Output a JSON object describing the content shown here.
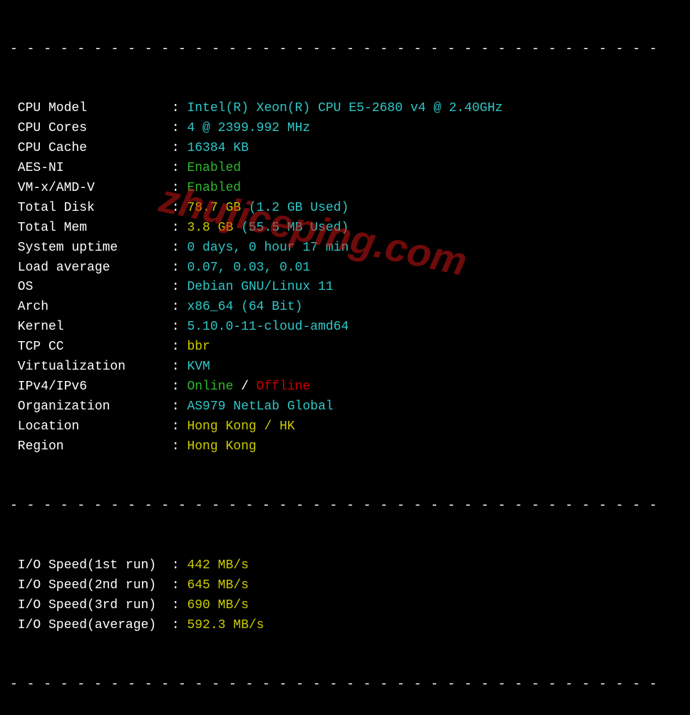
{
  "divider": "- - - - - - - - - - - - - - - - - - - - - - - - - - - - - - - - - - - - - - -",
  "rows": [
    {
      "label": "CPU Model           ",
      "parts": [
        {
          "c": "cyan",
          "t": "Intel(R) Xeon(R) CPU E5-2680 v4 @ 2.40GHz"
        }
      ]
    },
    {
      "label": "CPU Cores           ",
      "parts": [
        {
          "c": "cyan",
          "t": "4 @ 2399.992 MHz"
        }
      ]
    },
    {
      "label": "CPU Cache           ",
      "parts": [
        {
          "c": "cyan",
          "t": "16384 KB"
        }
      ]
    },
    {
      "label": "AES-NI              ",
      "parts": [
        {
          "c": "green",
          "t": "Enabled"
        }
      ]
    },
    {
      "label": "VM-x/AMD-V          ",
      "parts": [
        {
          "c": "green",
          "t": "Enabled"
        }
      ]
    },
    {
      "label": "Total Disk          ",
      "parts": [
        {
          "c": "yellow",
          "t": "78.7 GB "
        },
        {
          "c": "cyan",
          "t": "(1.2 GB Used)"
        }
      ]
    },
    {
      "label": "Total Mem           ",
      "parts": [
        {
          "c": "yellow",
          "t": "3.8 GB "
        },
        {
          "c": "cyan",
          "t": "(55.5 MB Used)"
        }
      ]
    },
    {
      "label": "System uptime       ",
      "parts": [
        {
          "c": "cyan",
          "t": "0 days, 0 hour 17 min"
        }
      ]
    },
    {
      "label": "Load average        ",
      "parts": [
        {
          "c": "cyan",
          "t": "0.07, 0.03, 0.01"
        }
      ]
    },
    {
      "label": "OS                  ",
      "parts": [
        {
          "c": "cyan",
          "t": "Debian GNU/Linux 11"
        }
      ]
    },
    {
      "label": "Arch                ",
      "parts": [
        {
          "c": "cyan",
          "t": "x86_64 (64 Bit)"
        }
      ]
    },
    {
      "label": "Kernel              ",
      "parts": [
        {
          "c": "cyan",
          "t": "5.10.0-11-cloud-amd64"
        }
      ]
    },
    {
      "label": "TCP CC              ",
      "parts": [
        {
          "c": "yellow",
          "t": "bbr"
        }
      ]
    },
    {
      "label": "Virtualization      ",
      "parts": [
        {
          "c": "cyan",
          "t": "KVM"
        }
      ]
    },
    {
      "label": "IPv4/IPv6           ",
      "parts": [
        {
          "c": "green",
          "t": "Online"
        },
        {
          "c": "white",
          "t": " / "
        },
        {
          "c": "red",
          "t": "Offline"
        }
      ]
    },
    {
      "label": "Organization        ",
      "parts": [
        {
          "c": "cyan",
          "t": "AS979 NetLab Global"
        }
      ]
    },
    {
      "label": "Location            ",
      "parts": [
        {
          "c": "yellow",
          "t": "Hong Kong / HK"
        }
      ]
    },
    {
      "label": "Region              ",
      "parts": [
        {
          "c": "yellow",
          "t": "Hong Kong"
        }
      ]
    }
  ],
  "io_rows": [
    {
      "label": "I/O Speed(1st run)  ",
      "parts": [
        {
          "c": "yellow",
          "t": "442 MB/s"
        }
      ]
    },
    {
      "label": "I/O Speed(2nd run)  ",
      "parts": [
        {
          "c": "yellow",
          "t": "645 MB/s"
        }
      ]
    },
    {
      "label": "I/O Speed(3rd run)  ",
      "parts": [
        {
          "c": "yellow",
          "t": "690 MB/s"
        }
      ]
    },
    {
      "label": "I/O Speed(average)  ",
      "parts": [
        {
          "c": "yellow",
          "t": "592.3 MB/s"
        }
      ]
    }
  ],
  "watermark": "zhujiceping.com"
}
